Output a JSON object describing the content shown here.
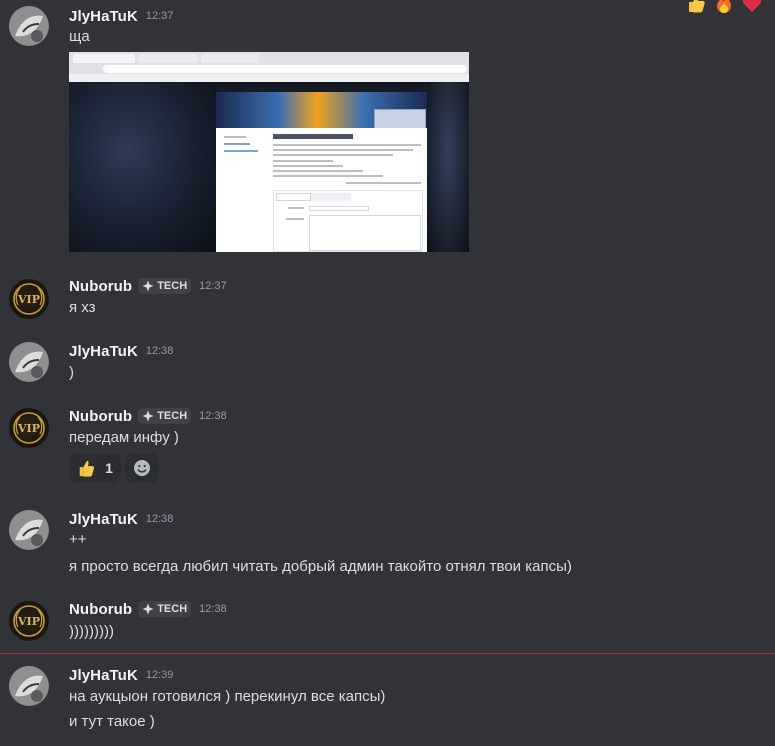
{
  "messages": [
    {
      "author": "JlyHaTuK",
      "time": "12:37",
      "lines": [
        "ща"
      ],
      "attachment": {
        "type": "screenshot",
        "page_heading": "Абуз, передача аккаунта / статы",
        "form_tabs": [
          "Выберите раздел",
          "Опишите проблему"
        ],
        "form_labels": [
          "Заголовок",
          "Сообщение"
        ]
      }
    },
    {
      "author": "Nuborub",
      "tag": "TECH",
      "time": "12:37",
      "lines": [
        "я хз"
      ]
    },
    {
      "author": "JlyHaTuK",
      "time": "12:38",
      "lines": [
        ")"
      ]
    },
    {
      "author": "Nuborub",
      "tag": "TECH",
      "time": "12:38",
      "lines": [
        "передам инфу )"
      ],
      "reaction": {
        "emoji": "thumbs-up",
        "count": "1"
      }
    },
    {
      "author": "JlyHaTuK",
      "time": "12:38",
      "lines": [
        "++",
        "я просто всегда любил читать добрый админ такойто отнял твои капсы)"
      ]
    },
    {
      "author": "Nuborub",
      "tag": "TECH",
      "time": "12:38",
      "lines": [
        ")))))))))"
      ]
    },
    {
      "author": "JlyHaTuK",
      "time": "12:39",
      "lines": [
        "на аукцыон готовился ) перекинул все капсы)",
        "и тут такое )"
      ]
    }
  ],
  "top_reactions": [
    "thumbs-up",
    "fire",
    "heart"
  ],
  "icons": {
    "tag": "crosshair-icon",
    "add_reaction": "smile-icon",
    "user_avatar": "user-avatar",
    "vip_avatar": "vip-badge-avatar"
  },
  "colors": {
    "background": "#323339",
    "new_message_line": "#a1323a",
    "author": "#f2f3f5",
    "timestamp": "#949ba4"
  }
}
